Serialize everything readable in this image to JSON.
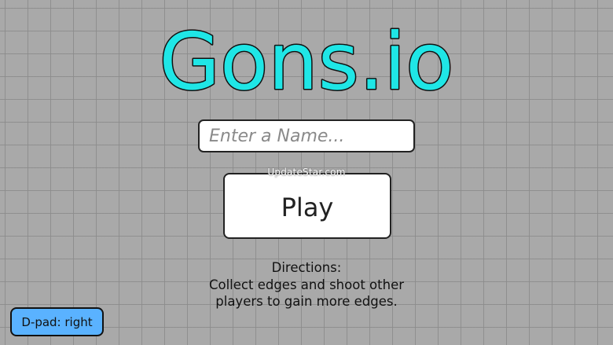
{
  "title": {
    "text": "Gons.io",
    "fill_color": "#1fe6e6",
    "outline_color": "#111111"
  },
  "name_input": {
    "value": "",
    "placeholder": "Enter a Name..."
  },
  "watermark": {
    "text": "UpdateStar.com"
  },
  "play_button": {
    "label": "Play"
  },
  "directions": {
    "heading": "Directions:",
    "line1": "Collect edges and shoot other",
    "line2": "players to gain more edges."
  },
  "dpad_button": {
    "label": "D-pad: right",
    "color": "#5ab2ff"
  },
  "background": {
    "color": "#a9a9a9",
    "grid_color": "#8c8c8c"
  }
}
